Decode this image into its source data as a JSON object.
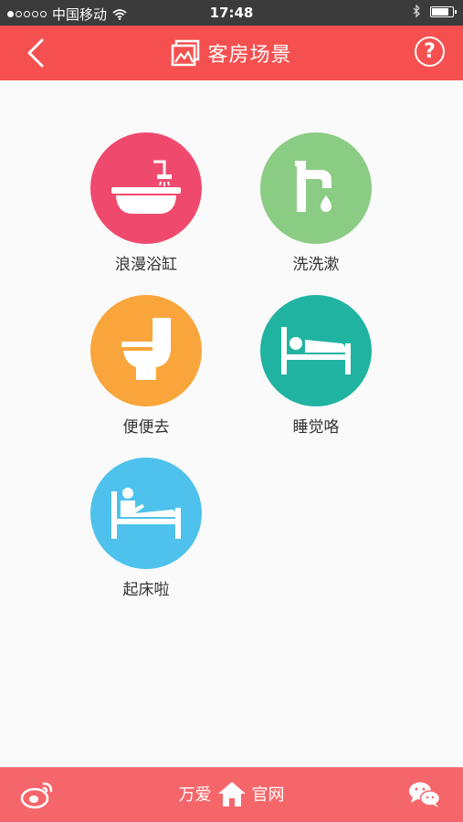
{
  "status_bar": {
    "carrier": "中国移动",
    "time": "17:48"
  },
  "nav": {
    "title": "客房场景",
    "help_label": "?"
  },
  "scenes": [
    {
      "label": "浪漫浴缸",
      "color": "#ef4a6e",
      "icon": "bathtub-icon"
    },
    {
      "label": "洗洗漱",
      "color": "#8bcc84",
      "icon": "faucet-icon"
    },
    {
      "label": "便便去",
      "color": "#f9a53b",
      "icon": "toilet-icon"
    },
    {
      "label": "睡觉咯",
      "color": "#21b3a2",
      "icon": "bed-sleep-icon"
    },
    {
      "label": "起床啦",
      "color": "#4ec2ed",
      "icon": "bed-wake-icon"
    }
  ],
  "bottom_bar": {
    "left_text": "万爱",
    "right_text": "官网"
  },
  "colors": {
    "nav_bg": "#f5504f",
    "bottom_bg": "#f5666a",
    "page_bg": "#fafafa"
  }
}
